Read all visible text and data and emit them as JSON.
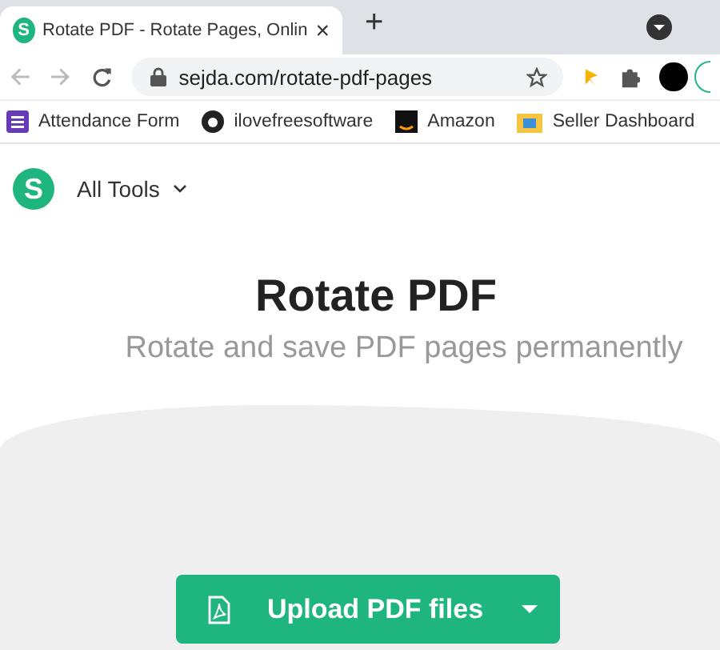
{
  "browser": {
    "tab": {
      "favicon": "S",
      "title": "Rotate PDF - Rotate Pages, Onlin",
      "close": "×",
      "selected": true
    },
    "new_tab": "+",
    "url": "sejda.com/rotate-pdf-pages",
    "bookmarks": [
      "Attendance Form",
      "ilovefreesoftware",
      "Amazon",
      "Seller Dashboard"
    ]
  },
  "page": {
    "logo": "S",
    "menu": "All Tools",
    "title": "Rotate PDF",
    "subtitle": "Rotate and save PDF pages permanently",
    "upload_button": "Upload PDF files"
  }
}
